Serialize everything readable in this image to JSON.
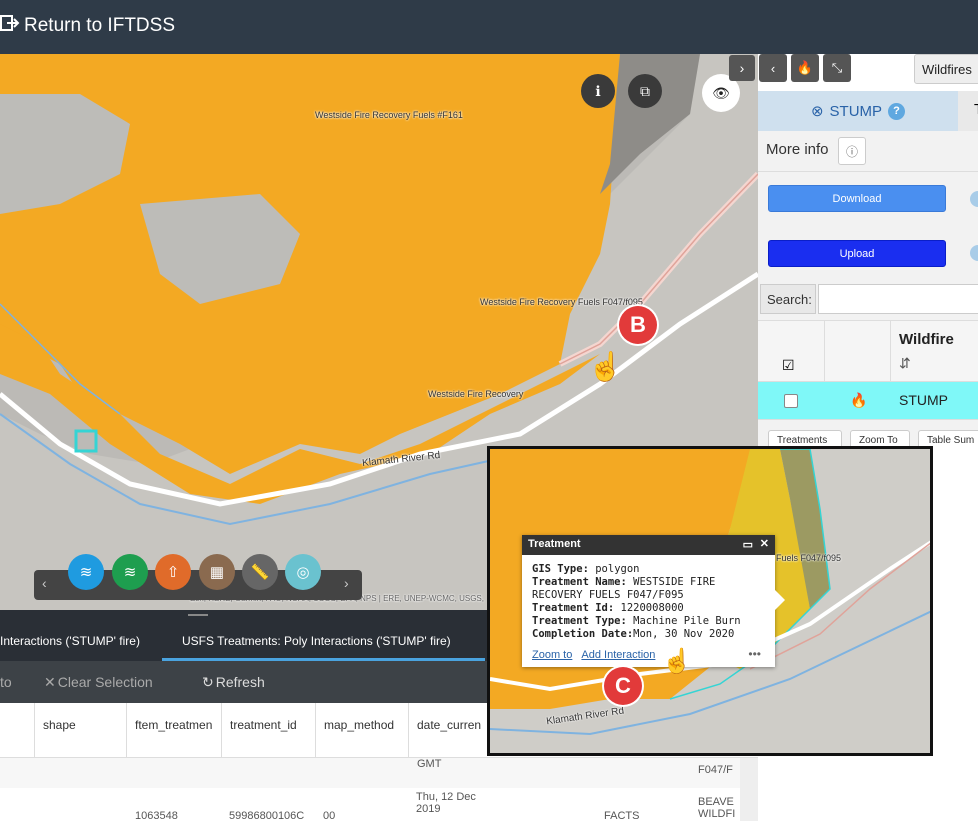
{
  "header": {
    "back_label": "Return to IFTDSS"
  },
  "map": {
    "labels": [
      "Westside Fire Recovery Fuels #F161",
      "Westside Fire Recovery Fuels F047/f095",
      "Westside Fire Recovery",
      "Klamath River Rd"
    ],
    "attribution": "Esri, HERE, Garmin, FAO, NOAA, USGS, EPA, NPS | ERE, UNEP-WCMC, USGS,",
    "markers": {
      "b": "B",
      "c": "C"
    }
  },
  "bottom_panel": {
    "tabs": [
      "Interactions ('STUMP' fire)",
      "USFS Treatments: Poly Interactions ('STUMP' fire)"
    ],
    "actions": {
      "zoom_to": "to",
      "clear_selection": "Clear Selection",
      "refresh": "Refresh"
    },
    "columns": [
      "shape",
      "ftem_treatmen",
      "treatment_id",
      "map_method",
      "date_curren"
    ],
    "rows": [
      {
        "date": "GMT",
        "extra": "F047/F"
      },
      {
        "ftem": "1063548",
        "treatment_id": "59986800106C",
        "map_method": "00",
        "date": "Thu, 12 Dec 2019",
        "source": "FACTS",
        "extra": "BEAVE WILDFI"
      }
    ]
  },
  "right_panel": {
    "wildfires_tab": "Wildfires",
    "stump_tab": "STUMP",
    "tab2_initial": "T",
    "more_info": "More info",
    "download": "Download",
    "upload": "Upload",
    "search_label": "Search:",
    "table": {
      "column": "Wildfire",
      "row_name": "STUMP"
    },
    "buttons": [
      "Treatments",
      "Zoom To",
      "Table Sum"
    ]
  },
  "popup": {
    "title": "Treatment",
    "gis_type_label": "GIS Type:",
    "gis_type": "polygon",
    "name_label": "Treatment Name:",
    "name": "WESTSIDE FIRE RECOVERY FUELS F047/F095",
    "id_label": "Treatment Id:",
    "id": "1220008000",
    "type_label": "Treatment Type:",
    "type": "Machine Pile Burn",
    "date_label": "Completion Date:",
    "date": "Mon, 30 Nov 2020",
    "zoom_link": "Zoom to",
    "add_link": "Add Interaction",
    "inset_labels": [
      "Fuels F047/f095",
      "Klamath River Rd"
    ]
  }
}
